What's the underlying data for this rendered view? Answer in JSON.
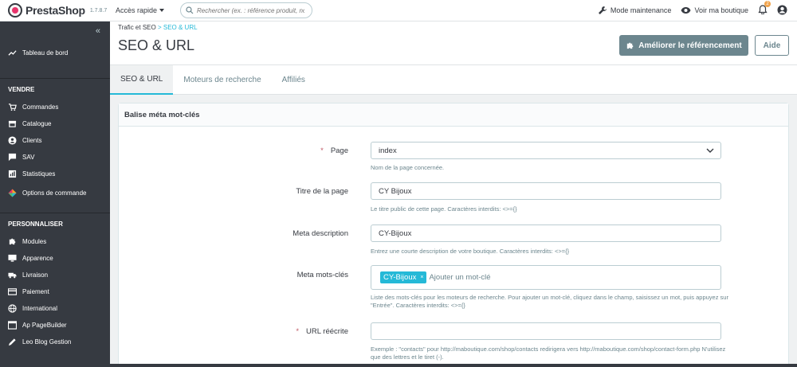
{
  "topbar": {
    "logo_text": "PrestaShop",
    "version": "1.7.8.7",
    "quick_access": "Accès rapide",
    "search_placeholder": "Rechercher (ex. : référence produit, no",
    "maintenance": "Mode maintenance",
    "view_shop": "Voir ma boutique",
    "notifications_count": "2"
  },
  "sidebar": {
    "collapse": "«",
    "dashboard": "Tableau de bord",
    "section_sell": "VENDRE",
    "sell_items": [
      {
        "label": "Commandes",
        "icon": "cart-icon"
      },
      {
        "label": "Catalogue",
        "icon": "store-icon"
      },
      {
        "label": "Clients",
        "icon": "user-icon"
      },
      {
        "label": "SAV",
        "icon": "chat-icon"
      },
      {
        "label": "Statistiques",
        "icon": "stats-icon"
      },
      {
        "label": "Options de commande",
        "icon": "options-icon"
      }
    ],
    "section_customize": "PERSONNALISER",
    "customize_items": [
      {
        "label": "Modules",
        "icon": "puzzle-icon"
      },
      {
        "label": "Apparence",
        "icon": "monitor-icon"
      },
      {
        "label": "Livraison",
        "icon": "truck-icon"
      },
      {
        "label": "Paiement",
        "icon": "card-icon"
      },
      {
        "label": "International",
        "icon": "globe-icon"
      },
      {
        "label": "Ap PageBuilder",
        "icon": "window-icon"
      },
      {
        "label": "Leo Blog Gestion",
        "icon": "pen-icon"
      }
    ]
  },
  "header": {
    "breadcrumb_parent": "Trafic et SEO",
    "breadcrumb_sep": ">",
    "breadcrumb_current": "SEO & URL",
    "title": "SEO & URL",
    "improve_button": "Améliorer le référencement",
    "help_button": "Aide"
  },
  "tabs": [
    {
      "label": "SEO & URL",
      "active": true
    },
    {
      "label": "Moteurs de recherche",
      "active": false
    },
    {
      "label": "Affiliés",
      "active": false
    }
  ],
  "panel": {
    "heading": "Balise méta mot-clés",
    "page_label": "Page",
    "page_value": "index",
    "page_help": "Nom de la page concernée.",
    "title_label": "Titre de la page",
    "title_value": "CY Bijoux",
    "title_help": "Le titre public de cette page. Caractères interdits: <>={}",
    "desc_label": "Meta description",
    "desc_value": "CY-Bijoux",
    "desc_help": "Entrez une courte description de votre boutique. Caractères interdits: <>={}",
    "keywords_label": "Meta mots-clés",
    "keyword_tag": "CY-Bijoux",
    "keyword_tag_remove": "×",
    "keyword_placeholder": "Ajouter un mot-clé",
    "keywords_help": "Liste des mots-clés pour les moteurs de recherche. Pour ajouter un mot-clé, cliquez dans le champ, saisissez un mot, puis appuyez sur \"Entrée\". Caractères interdits: <>={}",
    "url_label": "URL réécrite",
    "url_value": "",
    "url_help": "Exemple : \"contacts\" pour http://maboutique.com/shop/contacts redirigera vers http://maboutique.com/shop/contact-form.php N'utilisez que des lettres et le tiret (-).",
    "required_mark": "*"
  },
  "colors": {
    "accent": "#25b9d7",
    "sidebar": "#363a41",
    "button_secondary": "#6c868e",
    "required": "#c05c67"
  }
}
